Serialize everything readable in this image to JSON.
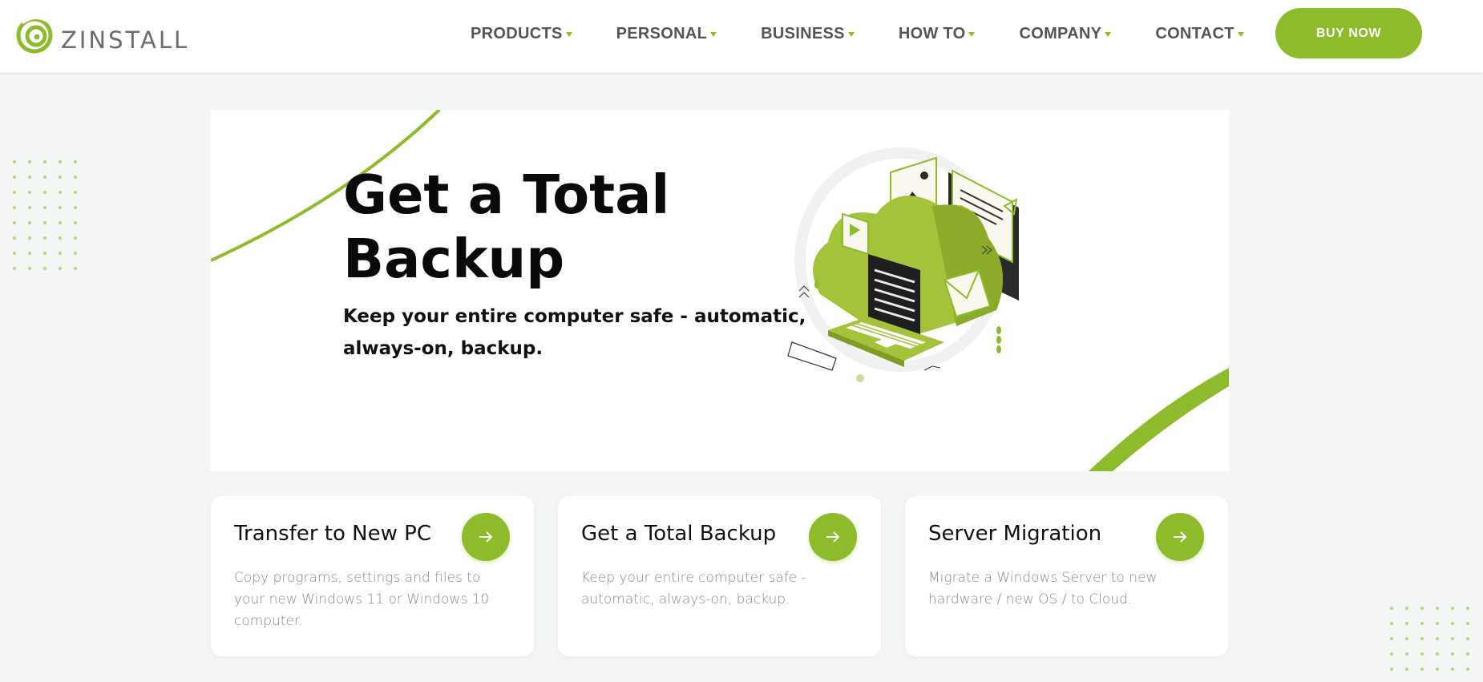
{
  "brand": {
    "name": "ZINSTALL",
    "accent": "#8dbb2b"
  },
  "nav": {
    "items": [
      {
        "label": "PRODUCTS"
      },
      {
        "label": "PERSONAL"
      },
      {
        "label": "BUSINESS"
      },
      {
        "label": "HOW TO"
      },
      {
        "label": "COMPANY"
      },
      {
        "label": "CONTACT"
      }
    ],
    "buy_label": "BUY NOW"
  },
  "hero": {
    "title_line1": "Get a Total",
    "title_line2": "Backup",
    "subtitle_line1": "Keep your entire computer safe - automatic,",
    "subtitle_line2": "always-on, backup.",
    "illustration": "cloud-backup-laptop-illustration"
  },
  "cards": [
    {
      "title": "Transfer to New PC",
      "desc": "Copy programs, settings and files to your new Windows 11 or Windows 10 computer.",
      "icon": "arrow-right-icon"
    },
    {
      "title": "Get a Total Backup",
      "desc": "Keep your entire computer safe - automatic, always-on, backup.",
      "icon": "arrow-right-icon"
    },
    {
      "title": "Server Migration",
      "desc": "Migrate a Windows Server to new hardware / new OS / to Cloud.",
      "icon": "arrow-right-icon"
    }
  ]
}
